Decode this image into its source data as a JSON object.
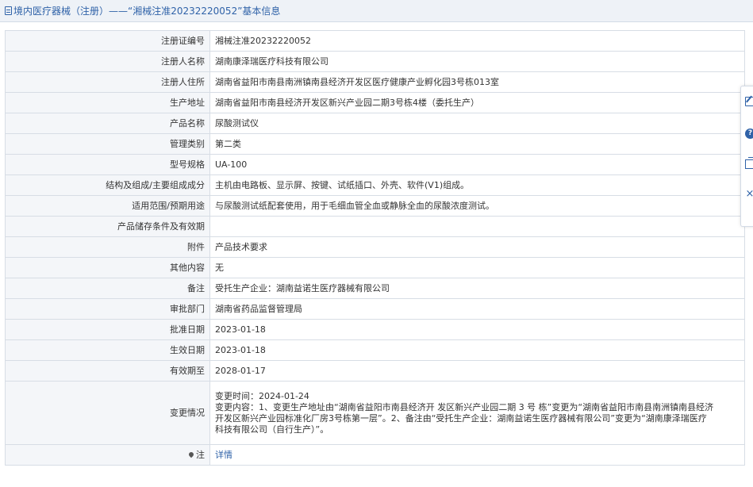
{
  "header": {
    "title": "境内医疗器械（注册）——“湘械注准20232220052”基本信息"
  },
  "fields": [
    {
      "label": "注册证编号",
      "value": "湘械注准20232220052"
    },
    {
      "label": "注册人名称",
      "value": "湖南康泽瑞医疗科技有限公司"
    },
    {
      "label": "注册人住所",
      "value": "湖南省益阳市南县南洲镇南县经济开发区医疗健康产业孵化园3号栋013室"
    },
    {
      "label": "生产地址",
      "value": "湖南省益阳市南县经济开发区新兴产业园二期3号栋4楼（委托生产）"
    },
    {
      "label": "产品名称",
      "value": "尿酸测试仪"
    },
    {
      "label": "管理类别",
      "value": "第二类"
    },
    {
      "label": "型号规格",
      "value": "UA-100"
    },
    {
      "label": "结构及组成/主要组成成分",
      "value": "主机由电路板、显示屏、按键、试纸插口、外壳、软件(V1)组成。"
    },
    {
      "label": "适用范围/预期用途",
      "value": "与尿酸测试纸配套使用，用于毛细血管全血或静脉全血的尿酸浓度测试。"
    },
    {
      "label": "产品储存条件及有效期",
      "value": ""
    },
    {
      "label": "附件",
      "value": "产品技术要求"
    },
    {
      "label": "其他内容",
      "value": "无"
    },
    {
      "label": "备注",
      "value": "受托生产企业：湖南益诺生医疗器械有限公司"
    },
    {
      "label": "审批部门",
      "value": "湖南省药品监督管理局"
    },
    {
      "label": "批准日期",
      "value": "2023-01-18"
    },
    {
      "label": "生效日期",
      "value": "2023-01-18"
    },
    {
      "label": "有效期至",
      "value": "2028-01-17"
    }
  ],
  "change": {
    "label": "变更情况",
    "time": "变更时间：2024-01-24",
    "content_line1": "变更内容：1、变更生产地址由“湖南省益阳市南县经济开 发区新兴产业园二期 3 号 栋”变更为“湖南省益阳市南县南洲镇南县经济",
    "content_line2": "开发区新兴产业园标准化厂房3号栋第一层”。2、备注由“受托生产企业：湖南益诺生医疗器械有限公司”变更为“湖南康泽瑞医疗",
    "content_line3": "科技有限公司（自行生产）”。"
  },
  "note": {
    "label": "注",
    "link": "详情"
  },
  "side_tools": {
    "help_glyph": "?",
    "close_glyph": "×"
  },
  "colors": {
    "accent": "#2f62a8",
    "label_bg": "#f4f6f9",
    "border": "#d7dde5",
    "header_bg": "#eef2f7"
  }
}
